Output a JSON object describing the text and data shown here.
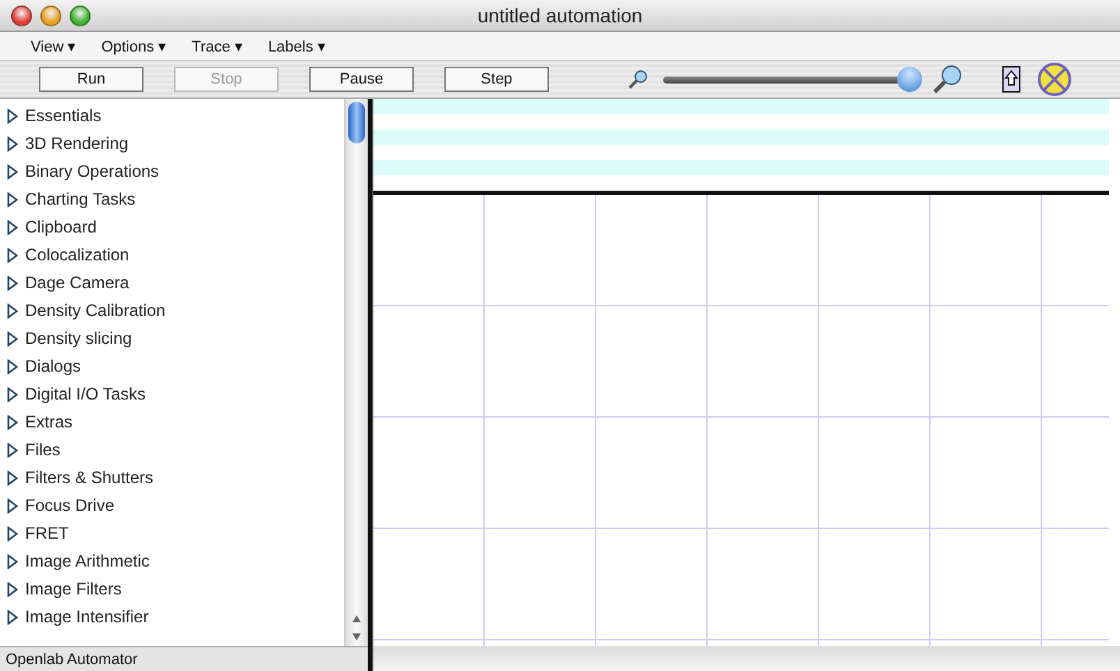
{
  "window": {
    "title": "untitled automation"
  },
  "menus": [
    "View ▾",
    "Options ▾",
    "Trace ▾",
    "Labels ▾"
  ],
  "buttons": [
    {
      "label": "Run",
      "disabled": false
    },
    {
      "label": "Stop",
      "disabled": true
    },
    {
      "label": "Pause",
      "disabled": false
    },
    {
      "label": "Step",
      "disabled": false
    }
  ],
  "zoom_slider": {
    "level": 0.97
  },
  "tasks": [
    "Essentials",
    "3D Rendering",
    "Binary Operations",
    "Charting Tasks",
    "Clipboard",
    "Colocalization",
    "Dage Camera",
    "Density Calibration",
    "Density slicing",
    "Dialogs",
    "Digital I/O Tasks",
    "Extras",
    "Files",
    "Filters & Shutters",
    "Focus Drive",
    "FRET",
    "Image Arithmetic",
    "Image Filters",
    "Image Intensifier"
  ],
  "status_bar": "Openlab Automator"
}
